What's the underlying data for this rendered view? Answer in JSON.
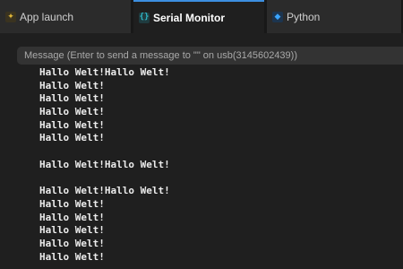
{
  "tabs": [
    {
      "label": "App launch",
      "icon": "app-launch-icon",
      "active": false
    },
    {
      "label": "Serial Monitor",
      "icon": "serial-monitor-icon",
      "active": true
    },
    {
      "label": "Python",
      "icon": "python-icon",
      "active": false
    }
  ],
  "message_input": {
    "placeholder": "Message (Enter to send a message to \"\" on usb(3145602439))",
    "value": ""
  },
  "output_lines": [
    "Hallo Welt!Hallo Welt!",
    "Hallo Welt!",
    "Hallo Welt!",
    "Hallo Welt!",
    "Hallo Welt!",
    "Hallo Welt!",
    "",
    "Hallo Welt!Hallo Welt!",
    "",
    "Hallo Welt!Hallo Welt!",
    "Hallo Welt!",
    "Hallo Welt!",
    "Hallo Welt!",
    "Hallo Welt!",
    "Hallo Welt!"
  ],
  "colors": {
    "background": "#1f1f1f",
    "tabbar": "#181818",
    "active_tab_accent": "#3c8ee0",
    "output_text": "#ececec"
  }
}
